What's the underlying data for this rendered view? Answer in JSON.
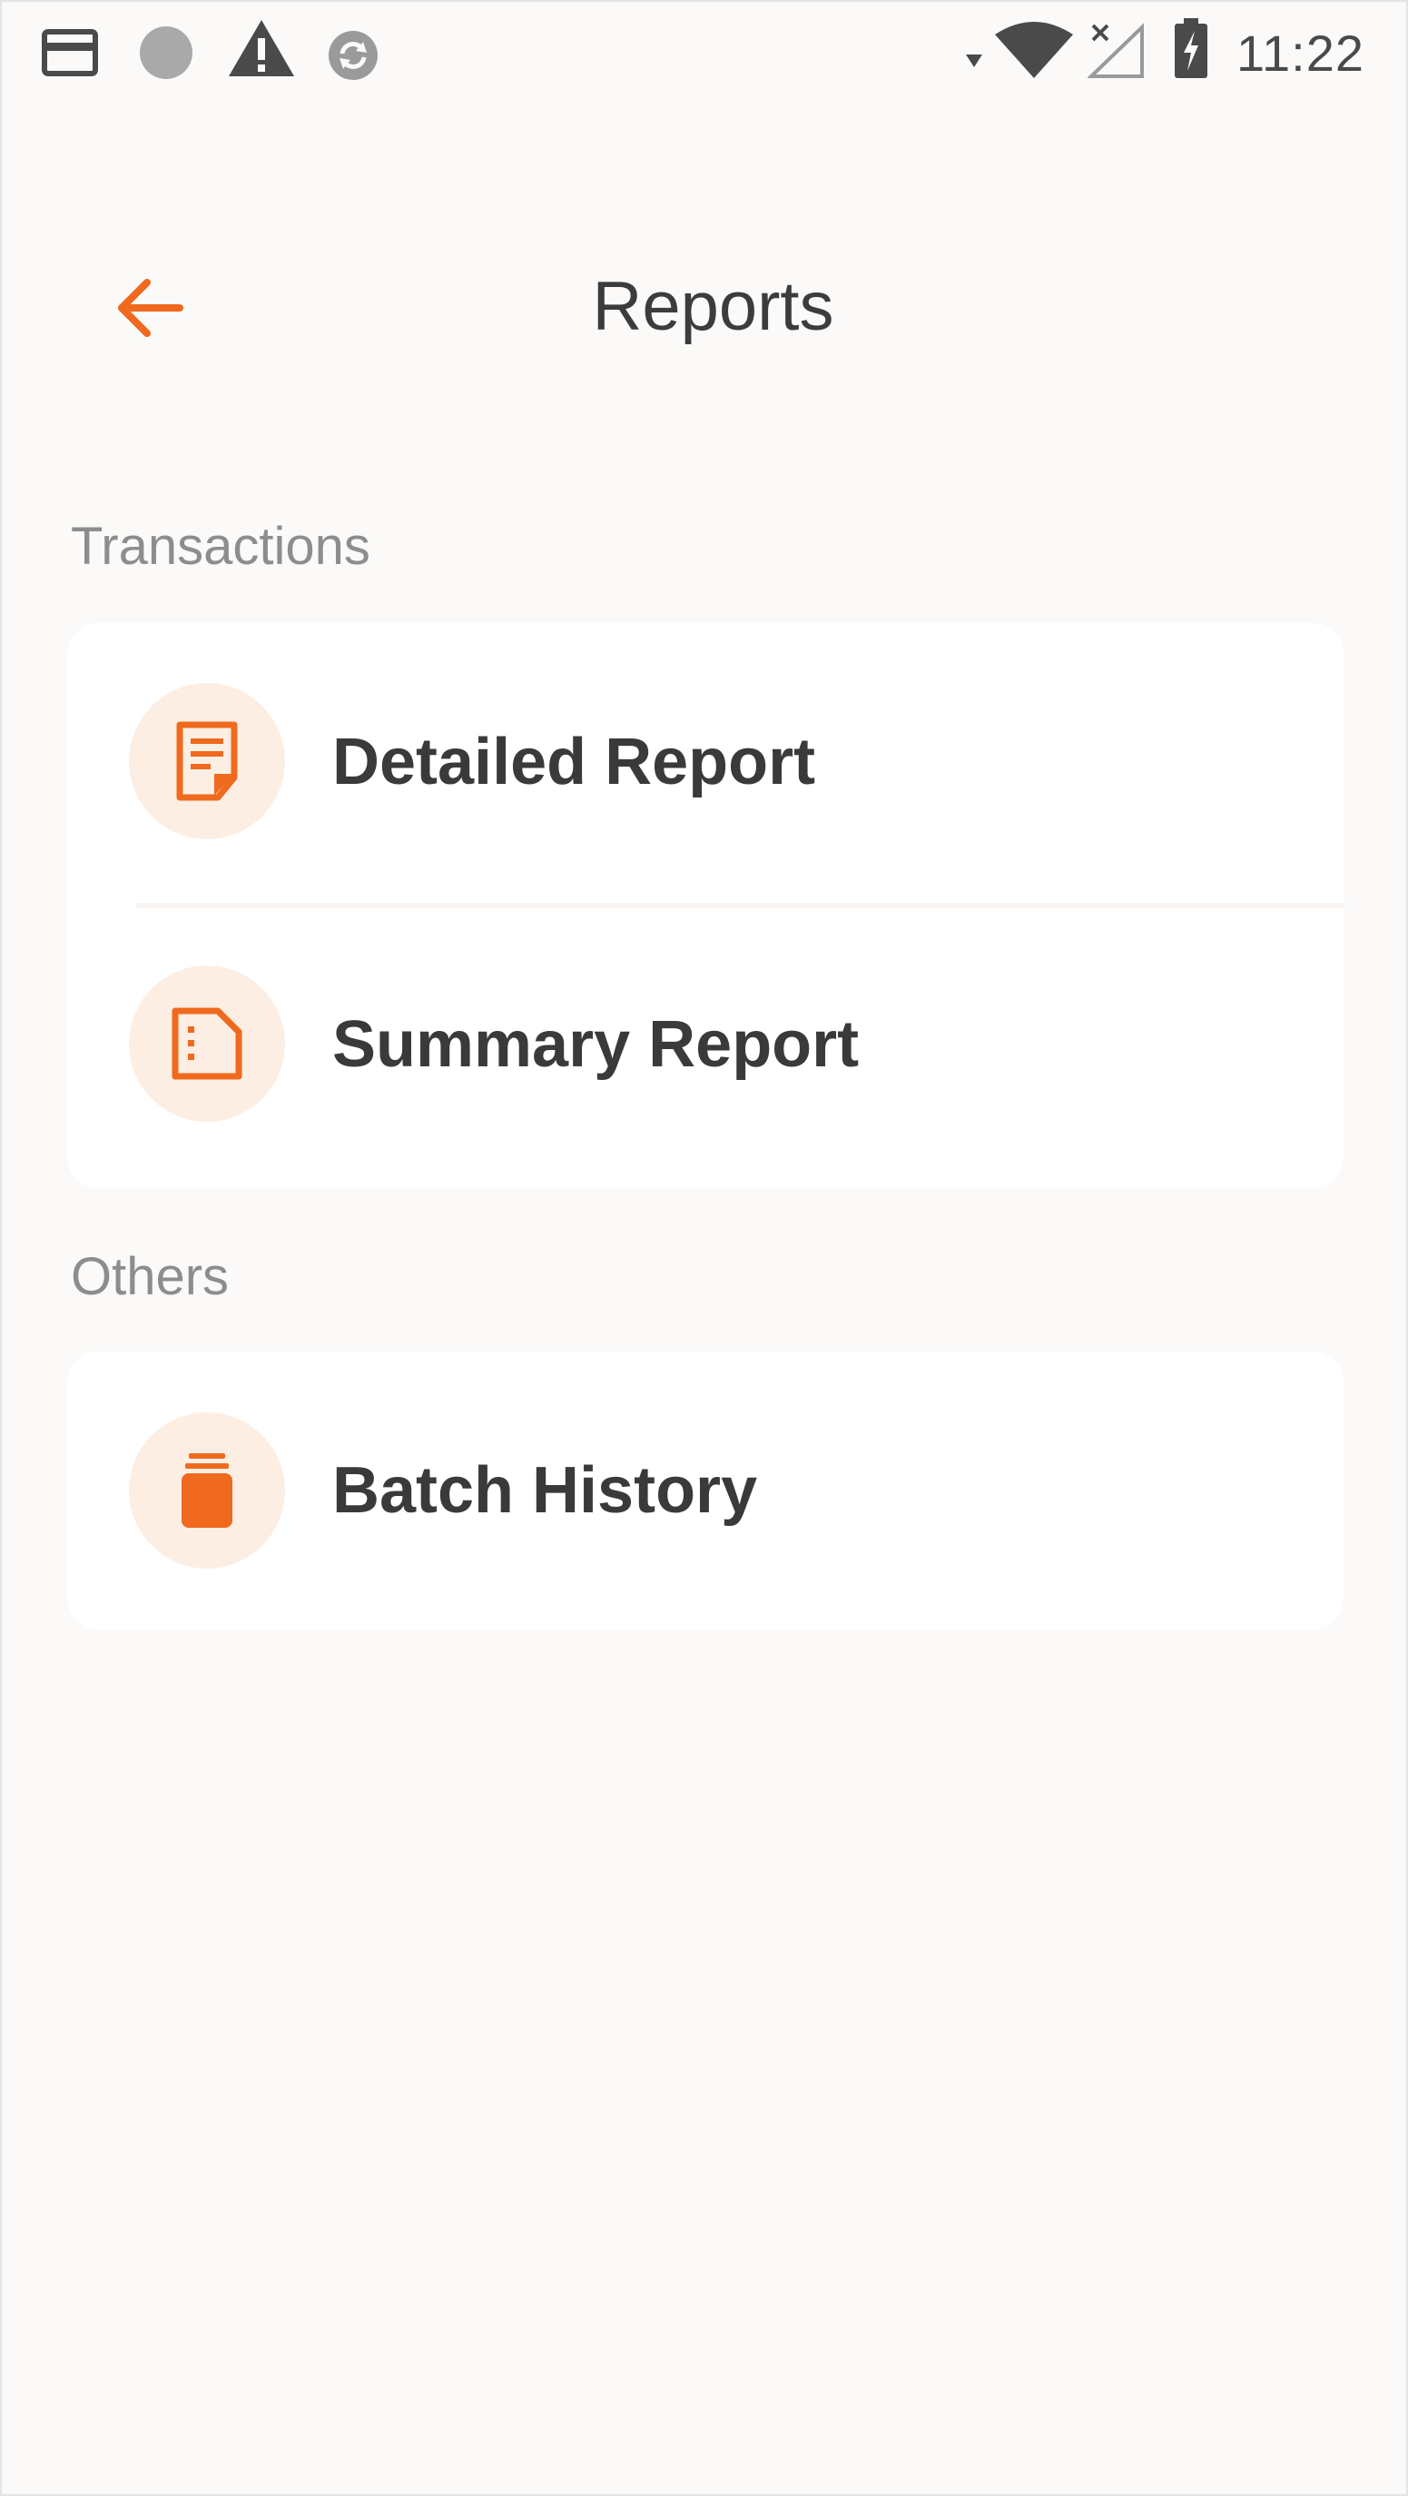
{
  "status_bar": {
    "time": "11:22"
  },
  "header": {
    "title": "Reports"
  },
  "sections": {
    "transactions": {
      "label": "Transactions",
      "items": [
        {
          "label": "Detailed Report",
          "icon": "detailed-report-icon"
        },
        {
          "label": "Summary Report",
          "icon": "summary-report-icon"
        }
      ]
    },
    "others": {
      "label": "Others",
      "items": [
        {
          "label": "Batch History",
          "icon": "batch-history-icon"
        }
      ]
    }
  },
  "colors": {
    "accent": "#ef6a1e",
    "icon_bg": "#fdeee3",
    "background": "#fbfaf9",
    "card": "#ffffff",
    "section_label": "#8d8d8d",
    "text": "#3a3a3a"
  }
}
